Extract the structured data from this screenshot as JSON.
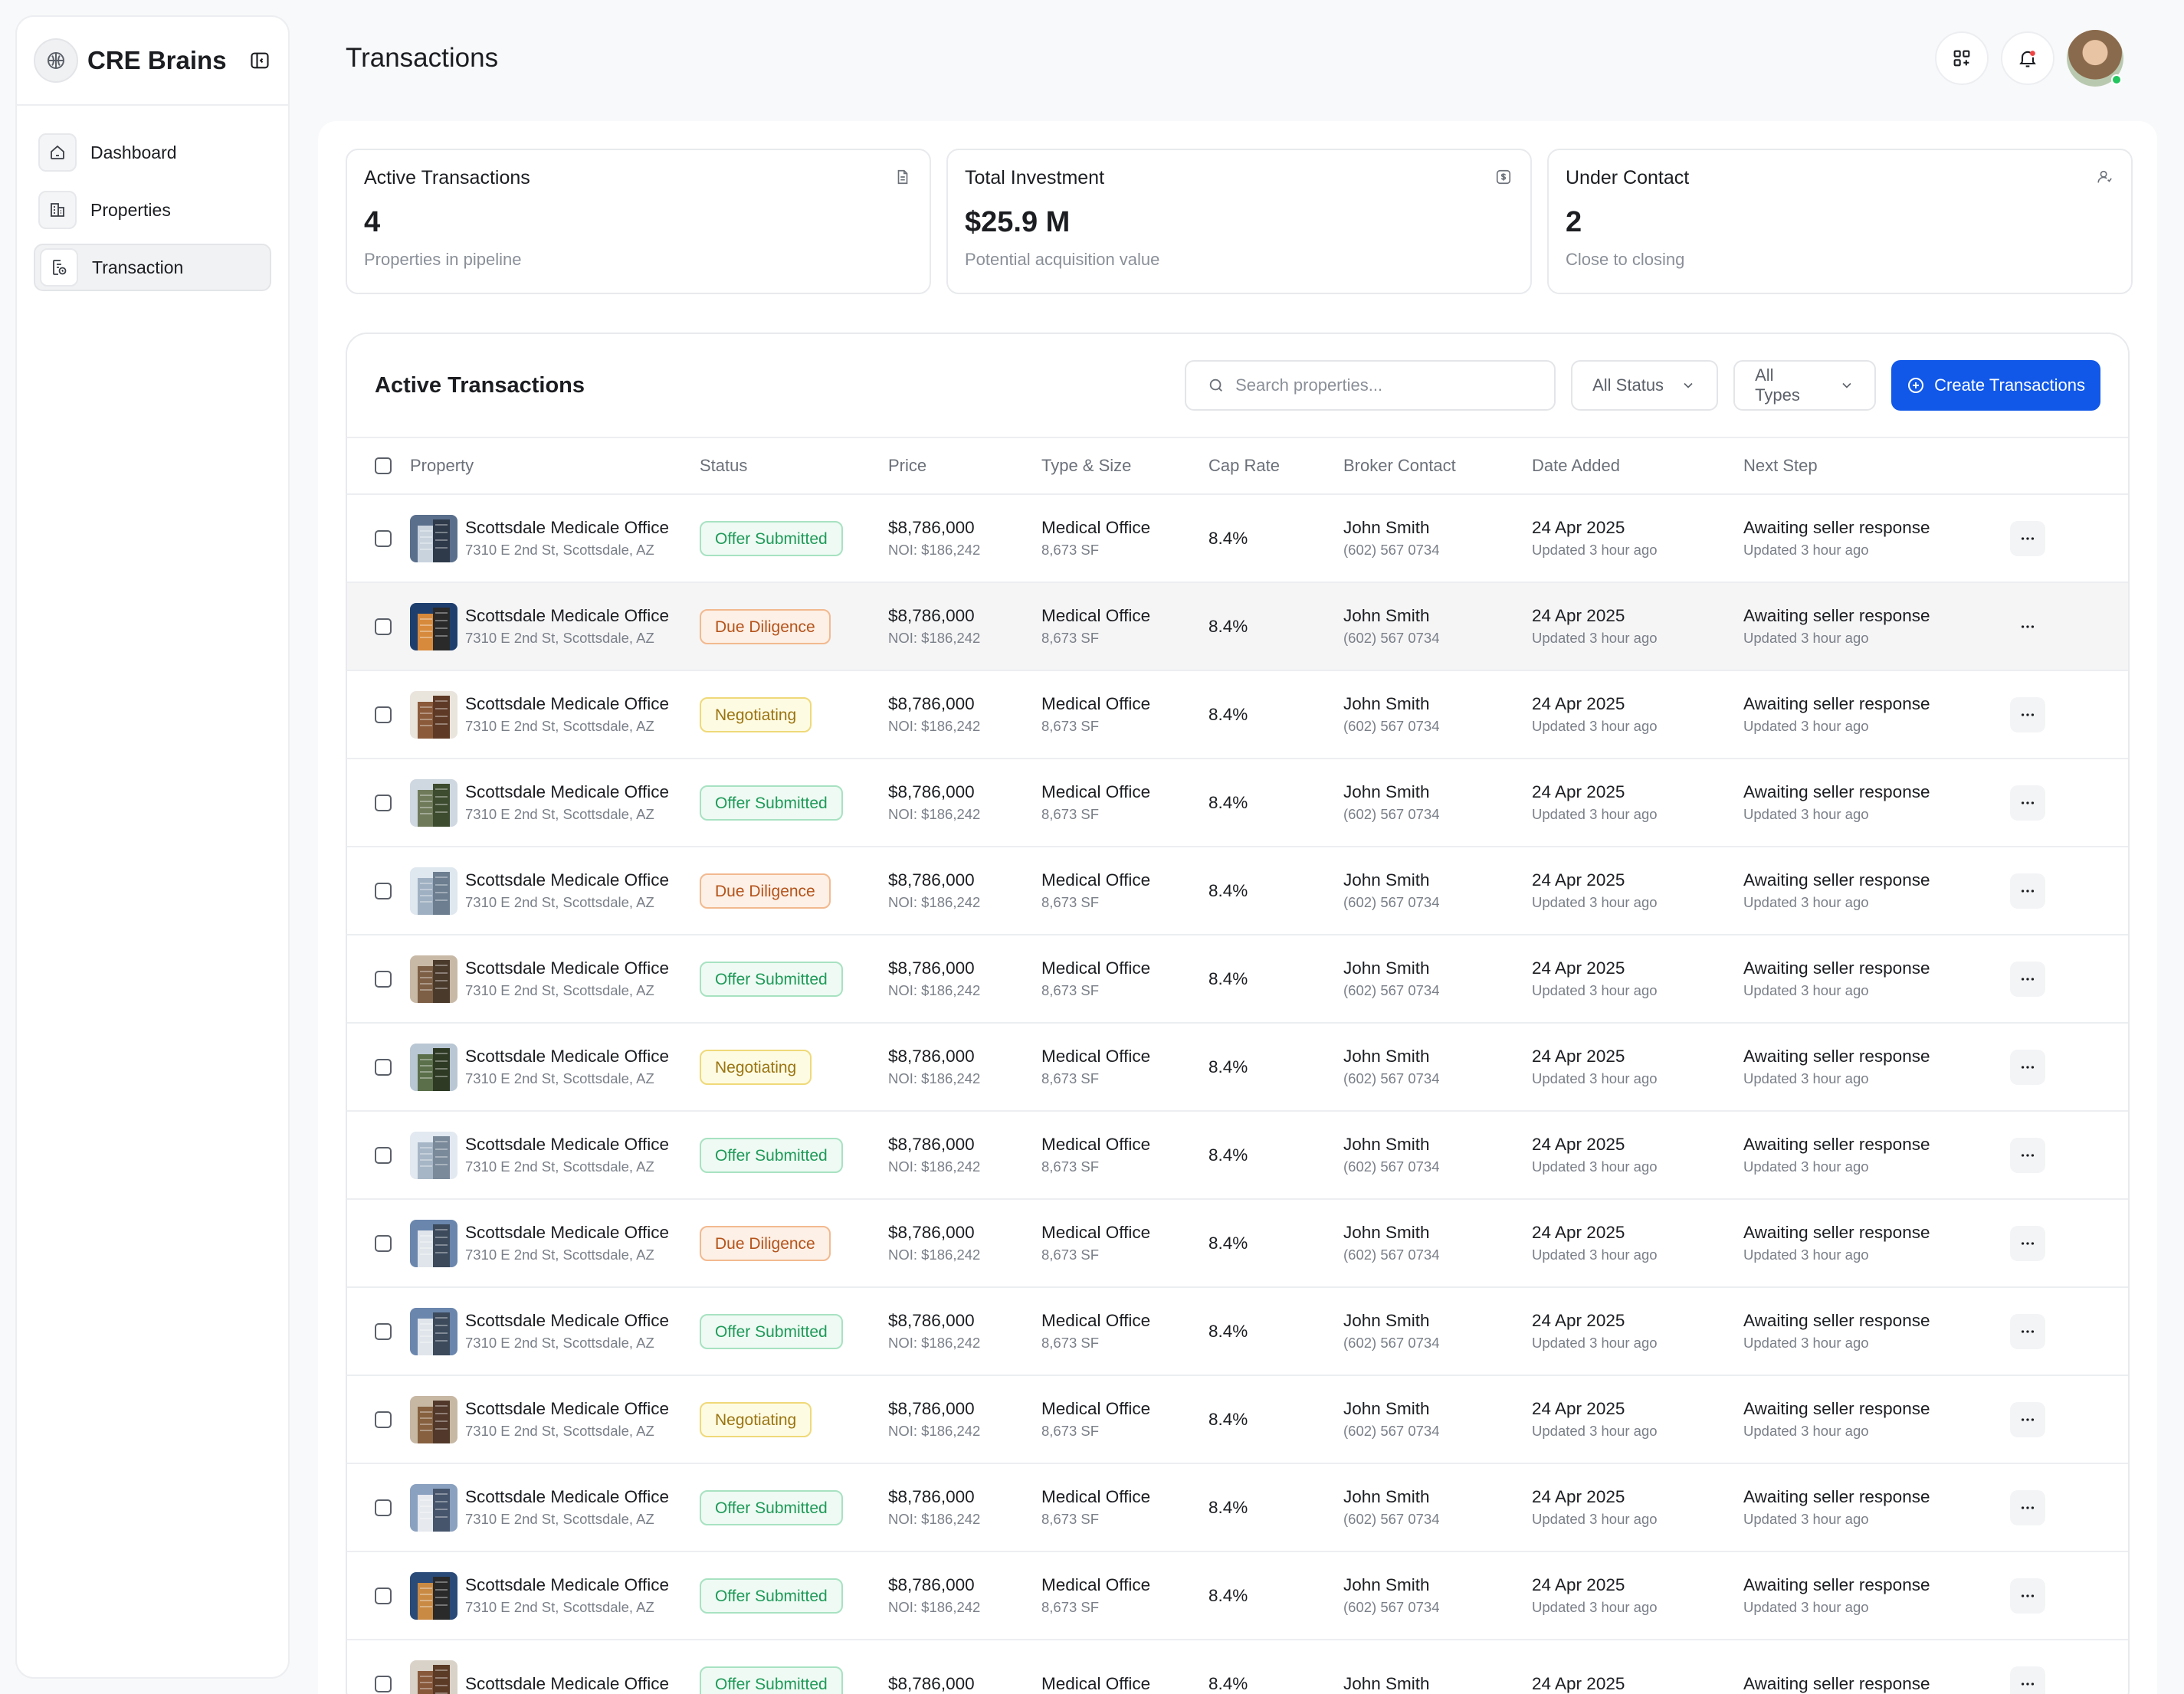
{
  "app": {
    "brand": "CRE Brains"
  },
  "sidebar": {
    "items": [
      {
        "label": "Dashboard",
        "icon": "home-icon"
      },
      {
        "label": "Properties",
        "icon": "building-icon"
      },
      {
        "label": "Transaction",
        "icon": "transaction-icon",
        "active": true
      }
    ]
  },
  "header": {
    "title": "Transactions"
  },
  "stats": [
    {
      "title": "Active Transactions",
      "value": "4",
      "sub": "Properties in pipeline",
      "icon": "document-icon"
    },
    {
      "title": "Total Investment",
      "value": "$25.9 M",
      "sub": "Potential acquisition value",
      "icon": "dollar-icon"
    },
    {
      "title": "Under Contact",
      "value": "2",
      "sub": "Close to closing",
      "icon": "user-icon"
    }
  ],
  "table": {
    "title": "Active Transactions",
    "search_placeholder": "Search properties...",
    "status_filter": "All Status",
    "type_filter": "All Types",
    "create_label": "Create Transactions",
    "columns": [
      "Property",
      "Status",
      "Price",
      "Type & Size",
      "Cap Rate",
      "Broker Contact",
      "Date Added",
      "Next Step"
    ],
    "rows": [
      {
        "name": "Scottsdale Medicale Office",
        "address": "7310 E 2nd St, Scottsdale, AZ",
        "status": "Offer Submitted",
        "status_kind": "offer",
        "price": "$8,786,000",
        "noi": "NOI: $186,242",
        "type": "Medical Office",
        "size": "8,673 SF",
        "cap": "8.4%",
        "broker": "John Smith",
        "phone": "(602) 567 0734",
        "date": "24 Apr 2025",
        "updated": "Updated 3 hour ago",
        "next": "Awaiting seller response",
        "next_updated": "Updated 3 hour ago"
      },
      {
        "name": "Scottsdale Medicale Office",
        "address": "7310 E 2nd St, Scottsdale, AZ",
        "status": "Due Diligence",
        "status_kind": "due",
        "price": "$8,786,000",
        "noi": "NOI: $186,242",
        "type": "Medical Office",
        "size": "8,673 SF",
        "cap": "8.4%",
        "broker": "John Smith",
        "phone": "(602) 567 0734",
        "date": "24 Apr 2025",
        "updated": "Updated 3 hour ago",
        "next": "Awaiting seller response",
        "next_updated": "Updated 3 hour ago"
      },
      {
        "name": "Scottsdale Medicale Office",
        "address": "7310 E 2nd St, Scottsdale, AZ",
        "status": "Negotiating",
        "status_kind": "neg",
        "price": "$8,786,000",
        "noi": "NOI: $186,242",
        "type": "Medical Office",
        "size": "8,673 SF",
        "cap": "8.4%",
        "broker": "John Smith",
        "phone": "(602) 567 0734",
        "date": "24 Apr 2025",
        "updated": "Updated 3 hour ago",
        "next": "Awaiting seller response",
        "next_updated": "Updated 3 hour ago"
      },
      {
        "name": "Scottsdale Medicale Office",
        "address": "7310 E 2nd St, Scottsdale, AZ",
        "status": "Offer Submitted",
        "status_kind": "offer",
        "price": "$8,786,000",
        "noi": "NOI: $186,242",
        "type": "Medical Office",
        "size": "8,673 SF",
        "cap": "8.4%",
        "broker": "John Smith",
        "phone": "(602) 567 0734",
        "date": "24 Apr 2025",
        "updated": "Updated 3 hour ago",
        "next": "Awaiting seller response",
        "next_updated": "Updated 3 hour ago"
      },
      {
        "name": "Scottsdale Medicale Office",
        "address": "7310 E 2nd St, Scottsdale, AZ",
        "status": "Due Diligence",
        "status_kind": "due",
        "price": "$8,786,000",
        "noi": "NOI: $186,242",
        "type": "Medical Office",
        "size": "8,673 SF",
        "cap": "8.4%",
        "broker": "John Smith",
        "phone": "(602) 567 0734",
        "date": "24 Apr 2025",
        "updated": "Updated 3 hour ago",
        "next": "Awaiting seller response",
        "next_updated": "Updated 3 hour ago"
      },
      {
        "name": "Scottsdale Medicale Office",
        "address": "7310 E 2nd St, Scottsdale, AZ",
        "status": "Offer Submitted",
        "status_kind": "offer",
        "price": "$8,786,000",
        "noi": "NOI: $186,242",
        "type": "Medical Office",
        "size": "8,673 SF",
        "cap": "8.4%",
        "broker": "John Smith",
        "phone": "(602) 567 0734",
        "date": "24 Apr 2025",
        "updated": "Updated 3 hour ago",
        "next": "Awaiting seller response",
        "next_updated": "Updated 3 hour ago"
      },
      {
        "name": "Scottsdale Medicale Office",
        "address": "7310 E 2nd St, Scottsdale, AZ",
        "status": "Negotiating",
        "status_kind": "neg",
        "price": "$8,786,000",
        "noi": "NOI: $186,242",
        "type": "Medical Office",
        "size": "8,673 SF",
        "cap": "8.4%",
        "broker": "John Smith",
        "phone": "(602) 567 0734",
        "date": "24 Apr 2025",
        "updated": "Updated 3 hour ago",
        "next": "Awaiting seller response",
        "next_updated": "Updated 3 hour ago"
      },
      {
        "name": "Scottsdale Medicale Office",
        "address": "7310 E 2nd St, Scottsdale, AZ",
        "status": "Offer Submitted",
        "status_kind": "offer",
        "price": "$8,786,000",
        "noi": "NOI: $186,242",
        "type": "Medical Office",
        "size": "8,673 SF",
        "cap": "8.4%",
        "broker": "John Smith",
        "phone": "(602) 567 0734",
        "date": "24 Apr 2025",
        "updated": "Updated 3 hour ago",
        "next": "Awaiting seller response",
        "next_updated": "Updated 3 hour ago"
      },
      {
        "name": "Scottsdale Medicale Office",
        "address": "7310 E 2nd St, Scottsdale, AZ",
        "status": "Due Diligence",
        "status_kind": "due",
        "price": "$8,786,000",
        "noi": "NOI: $186,242",
        "type": "Medical Office",
        "size": "8,673 SF",
        "cap": "8.4%",
        "broker": "John Smith",
        "phone": "(602) 567 0734",
        "date": "24 Apr 2025",
        "updated": "Updated 3 hour ago",
        "next": "Awaiting seller response",
        "next_updated": "Updated 3 hour ago"
      },
      {
        "name": "Scottsdale Medicale Office",
        "address": "7310 E 2nd St, Scottsdale, AZ",
        "status": "Offer Submitted",
        "status_kind": "offer",
        "price": "$8,786,000",
        "noi": "NOI: $186,242",
        "type": "Medical Office",
        "size": "8,673 SF",
        "cap": "8.4%",
        "broker": "John Smith",
        "phone": "(602) 567 0734",
        "date": "24 Apr 2025",
        "updated": "Updated 3 hour ago",
        "next": "Awaiting seller response",
        "next_updated": "Updated 3 hour ago"
      },
      {
        "name": "Scottsdale Medicale Office",
        "address": "7310 E 2nd St, Scottsdale, AZ",
        "status": "Negotiating",
        "status_kind": "neg",
        "price": "$8,786,000",
        "noi": "NOI: $186,242",
        "type": "Medical Office",
        "size": "8,673 SF",
        "cap": "8.4%",
        "broker": "John Smith",
        "phone": "(602) 567 0734",
        "date": "24 Apr 2025",
        "updated": "Updated 3 hour ago",
        "next": "Awaiting seller response",
        "next_updated": "Updated 3 hour ago"
      },
      {
        "name": "Scottsdale Medicale Office",
        "address": "7310 E 2nd St, Scottsdale, AZ",
        "status": "Offer Submitted",
        "status_kind": "offer",
        "price": "$8,786,000",
        "noi": "NOI: $186,242",
        "type": "Medical Office",
        "size": "8,673 SF",
        "cap": "8.4%",
        "broker": "John Smith",
        "phone": "(602) 567 0734",
        "date": "24 Apr 2025",
        "updated": "Updated 3 hour ago",
        "next": "Awaiting seller response",
        "next_updated": "Updated 3 hour ago"
      },
      {
        "name": "Scottsdale Medicale Office",
        "address": "7310 E 2nd St, Scottsdale, AZ",
        "status": "Offer Submitted",
        "status_kind": "offer",
        "price": "$8,786,000",
        "noi": "NOI: $186,242",
        "type": "Medical Office",
        "size": "8,673 SF",
        "cap": "8.4%",
        "broker": "John Smith",
        "phone": "(602) 567 0734",
        "date": "24 Apr 2025",
        "updated": "Updated 3 hour ago",
        "next": "Awaiting seller response",
        "next_updated": "Updated 3 hour ago"
      },
      {
        "name": "Scottsdale Medicale Office",
        "address": "",
        "status": "Offer Submitted",
        "status_kind": "offer",
        "price": "$8,786,000",
        "noi": "",
        "type": "Medical Office",
        "size": "",
        "cap": "8.4%",
        "broker": "John Smith",
        "phone": "",
        "date": "24 Apr 2025",
        "updated": "",
        "next": "Awaiting seller response",
        "next_updated": ""
      }
    ]
  }
}
